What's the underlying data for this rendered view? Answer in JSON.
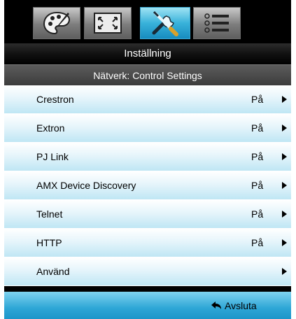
{
  "tabs": [
    {
      "icon": "palette-icon",
      "active": false
    },
    {
      "icon": "screen-fit-icon",
      "active": false
    },
    {
      "icon": "tools-icon",
      "active": true
    },
    {
      "icon": "list-icon",
      "active": false
    }
  ],
  "header": {
    "title": "Inställning",
    "subtitle": "Nätverk: Control Settings"
  },
  "menu": {
    "items": [
      {
        "label": "Crestron",
        "value": "På"
      },
      {
        "label": "Extron",
        "value": "På"
      },
      {
        "label": "PJ Link",
        "value": "På"
      },
      {
        "label": "AMX Device Discovery",
        "value": "På"
      },
      {
        "label": "Telnet",
        "value": "På"
      },
      {
        "label": "HTTP",
        "value": "På"
      },
      {
        "label": "Använd",
        "value": ""
      }
    ]
  },
  "footer": {
    "exit_label": "Avsluta",
    "exit_icon": "return-arrow-icon"
  },
  "colors": {
    "accent": "#2ea6d6",
    "row_tint": "#bfe6f4",
    "background": "#000000"
  }
}
